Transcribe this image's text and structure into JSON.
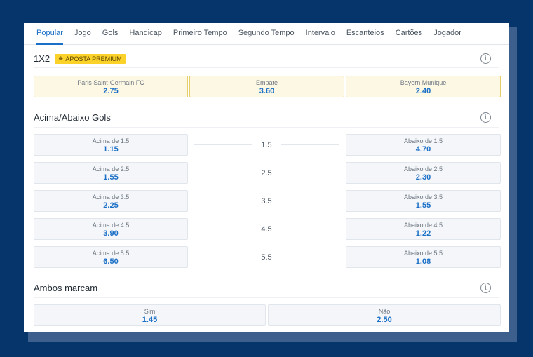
{
  "tabs": [
    "Popular",
    "Jogo",
    "Gols",
    "Handicap",
    "Primeiro Tempo",
    "Segundo Tempo",
    "Intervalo",
    "Escanteios",
    "Cartões",
    "Jogador"
  ],
  "market_1x2": {
    "title": "1X2",
    "badge": "APOSTA PREMIUM",
    "options": [
      {
        "label": "Paris Saint-Germain FC",
        "odd": "2.75"
      },
      {
        "label": "Empate",
        "odd": "3.60"
      },
      {
        "label": "Bayern Munique",
        "odd": "2.40"
      }
    ]
  },
  "over_under": {
    "title": "Acima/Abaixo Gols",
    "rows": [
      {
        "over_label": "Acima de 1.5",
        "over_odd": "1.15",
        "line": "1.5",
        "under_label": "Abaixo de 1.5",
        "under_odd": "4.70"
      },
      {
        "over_label": "Acima de 2.5",
        "over_odd": "1.55",
        "line": "2.5",
        "under_label": "Abaixo de 2.5",
        "under_odd": "2.30"
      },
      {
        "over_label": "Acima de 3.5",
        "over_odd": "2.25",
        "line": "3.5",
        "under_label": "Abaixo de 3.5",
        "under_odd": "1.55"
      },
      {
        "over_label": "Acima de 4.5",
        "over_odd": "3.90",
        "line": "4.5",
        "under_label": "Abaixo de 4.5",
        "under_odd": "1.22"
      },
      {
        "over_label": "Acima de 5.5",
        "over_odd": "6.50",
        "line": "5.5",
        "under_label": "Abaixo de 5.5",
        "under_odd": "1.08"
      }
    ]
  },
  "both_score": {
    "title": "Ambos marcam",
    "options": [
      {
        "label": "Sim",
        "odd": "1.45"
      },
      {
        "label": "Não",
        "odd": "2.50"
      }
    ]
  },
  "icons": {
    "info": "info-icon",
    "premium": "crown-icon"
  },
  "colors": {
    "background": "#05356b",
    "accent": "#1a6fc6",
    "premium": "#fbd22a"
  }
}
